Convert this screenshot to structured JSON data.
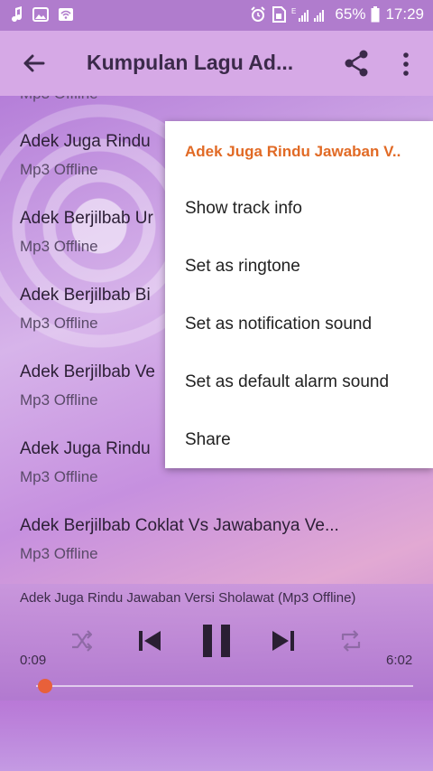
{
  "status_bar": {
    "time": "17:29",
    "battery": "65%"
  },
  "app_bar": {
    "title": "Kumpulan Lagu Ad..."
  },
  "list": {
    "partial_top": "Mp3 Offline",
    "items": [
      {
        "title": "Adek Juga Rindu",
        "subtitle": "Mp3 Offline"
      },
      {
        "title": "Adek Berjilbab Ur",
        "subtitle": "Mp3 Offline"
      },
      {
        "title": "Adek Berjilbab Bi",
        "subtitle": "Mp3 Offline"
      },
      {
        "title": "Adek Berjilbab Ve",
        "subtitle": "Mp3 Offline"
      },
      {
        "title": "Adek Juga Rindu",
        "subtitle": "Mp3 Offline"
      },
      {
        "title": "Adek Berjilbab Coklat Vs Jawabanya Ve...",
        "subtitle": "Mp3 Offline"
      }
    ]
  },
  "context_menu": {
    "header": "Adek Juga Rindu Jawaban V..",
    "items": [
      "Show track info",
      "Set as ringtone",
      "Set as notification sound",
      "Set as default alarm sound",
      "Share"
    ]
  },
  "player": {
    "now_playing": "Adek Juga Rindu Jawaban Versi Sholawat (Mp3 Offline)",
    "elapsed": "0:09",
    "duration": "6:02",
    "progress_fraction": 0.025
  },
  "colors": {
    "accent": "#e8603a",
    "menu_header": "#e16a25",
    "app_bar": "#d6a9e6",
    "status_bar": "#b07ccd"
  }
}
